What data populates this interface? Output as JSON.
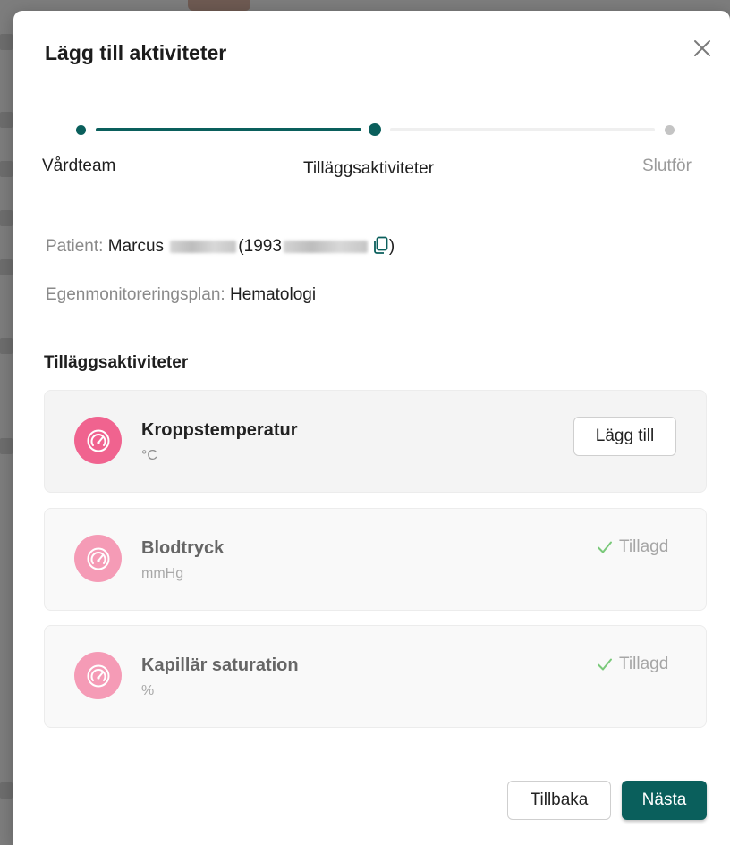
{
  "modal": {
    "title": "Lägg till aktiviteter",
    "close_icon": "close-icon"
  },
  "stepper": {
    "steps": [
      {
        "label": "Vårdteam",
        "state": "done"
      },
      {
        "label": "Tilläggsaktiviteter",
        "state": "current"
      },
      {
        "label": "Slutför",
        "state": "pending"
      }
    ],
    "colors": {
      "active": "#0a5f5c",
      "inactive": "#c4c4c4"
    }
  },
  "patient": {
    "label": "Patient",
    "separator": ":",
    "first_name": "Marcus",
    "id_prefix": "(1993",
    "id_suffix": ")",
    "copy_icon": "copy-icon"
  },
  "plan": {
    "label": "Egenmonitoreringsplan",
    "separator": ":",
    "value": "Hematologi"
  },
  "section_title": "Tilläggsaktiviteter",
  "activities": [
    {
      "name": "Kroppstemperatur",
      "unit": "°C",
      "action_label": "Lägg till",
      "added": false,
      "icon": "gauge-icon"
    },
    {
      "name": "Blodtryck",
      "unit": "mmHg",
      "added_label": "Tillagd",
      "added": true,
      "icon": "gauge-icon"
    },
    {
      "name": "Kapillär saturation",
      "unit": "%",
      "added_label": "Tillagd",
      "added": true,
      "icon": "gauge-icon"
    }
  ],
  "footer": {
    "back_label": "Tillbaka",
    "next_label": "Nästa"
  },
  "colors": {
    "primary": "#0a5f5c",
    "icon_active": "#f0638f",
    "icon_disabled": "#f59bb6",
    "check": "#7ac97a"
  }
}
